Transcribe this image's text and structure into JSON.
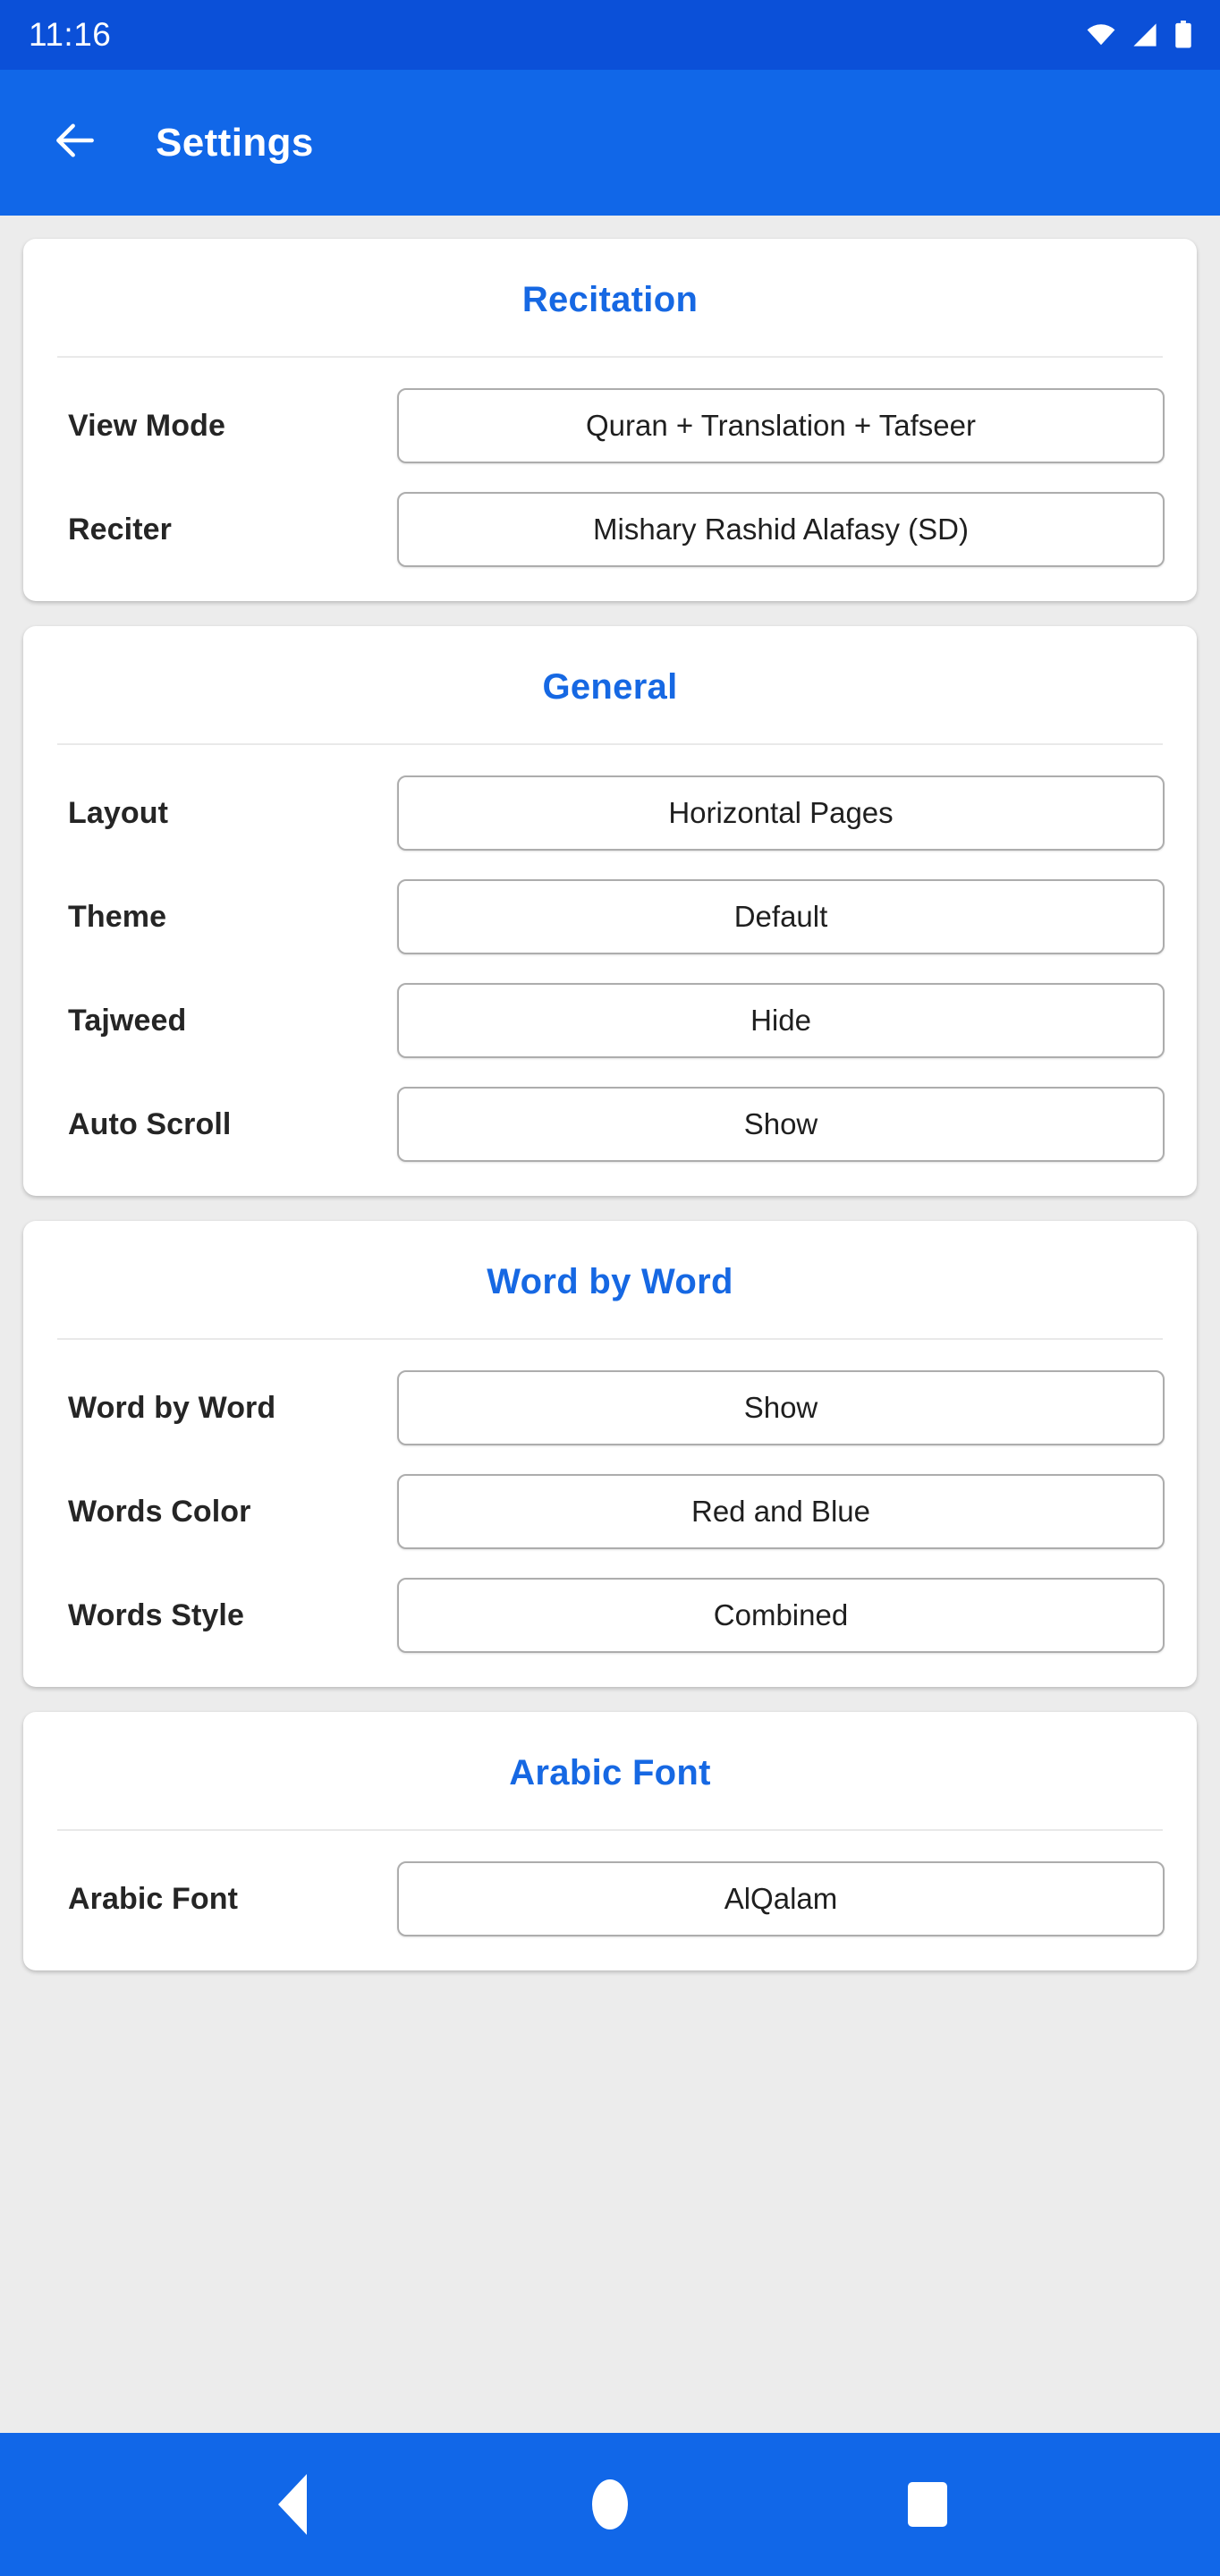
{
  "status_bar": {
    "time": "11:16",
    "icons": [
      "wifi-icon",
      "signal-icon",
      "battery-icon"
    ],
    "background": "#0b50d8"
  },
  "app_bar": {
    "title": "Settings",
    "back_icon": "arrow-left-icon",
    "background": "#1167e8",
    "text_color": "#ffffff"
  },
  "theme": {
    "page_background": "#ececec",
    "card_background": "#ffffff",
    "section_title_color": "#1668e3",
    "label_color": "#252525",
    "dropdown_border": "#adadad"
  },
  "sections": [
    {
      "title": "Recitation",
      "rows": [
        {
          "label": "View Mode",
          "value": "Quran + Translation + Tafseer"
        },
        {
          "label": "Reciter",
          "value": "Mishary Rashid Alafasy (SD)"
        }
      ]
    },
    {
      "title": "General",
      "rows": [
        {
          "label": "Layout",
          "value": "Horizontal Pages"
        },
        {
          "label": "Theme",
          "value": "Default"
        },
        {
          "label": "Tajweed",
          "value": "Hide"
        },
        {
          "label": "Auto Scroll",
          "value": "Show"
        }
      ]
    },
    {
      "title": "Word by Word",
      "rows": [
        {
          "label": "Word by Word",
          "value": "Show"
        },
        {
          "label": "Words Color",
          "value": "Red and Blue"
        },
        {
          "label": "Words Style",
          "value": "Combined"
        }
      ]
    },
    {
      "title": "Arabic Font",
      "rows": [
        {
          "label": "Arabic Font",
          "value": "AlQalam"
        }
      ]
    }
  ],
  "nav_bar": {
    "background": "#1167e8",
    "buttons": [
      {
        "name": "back",
        "icon": "triangle-left-icon"
      },
      {
        "name": "home",
        "icon": "circle-icon"
      },
      {
        "name": "recents",
        "icon": "square-icon"
      }
    ]
  }
}
